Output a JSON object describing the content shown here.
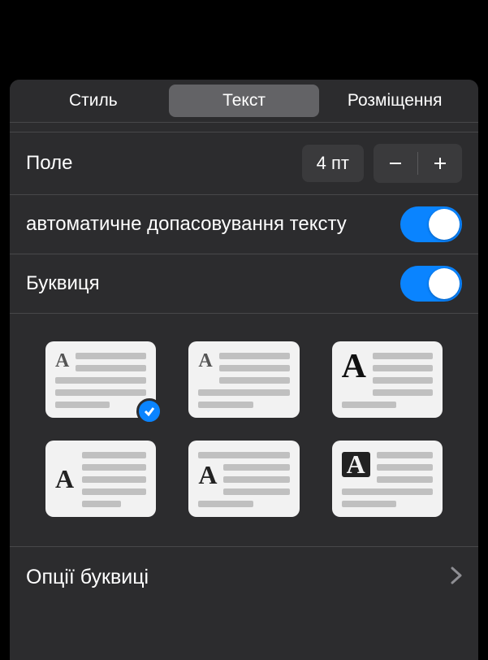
{
  "tabs": {
    "style": "Стиль",
    "text": "Текст",
    "arrange": "Розміщення"
  },
  "margin": {
    "label": "Поле",
    "value": "4 пт"
  },
  "autofit": {
    "label": "автоматичне допасовування тексту",
    "on": true
  },
  "dropcap": {
    "label": "Буквиця",
    "on": true,
    "selected_index": 0
  },
  "options_row": {
    "label": "Опції буквиці"
  }
}
